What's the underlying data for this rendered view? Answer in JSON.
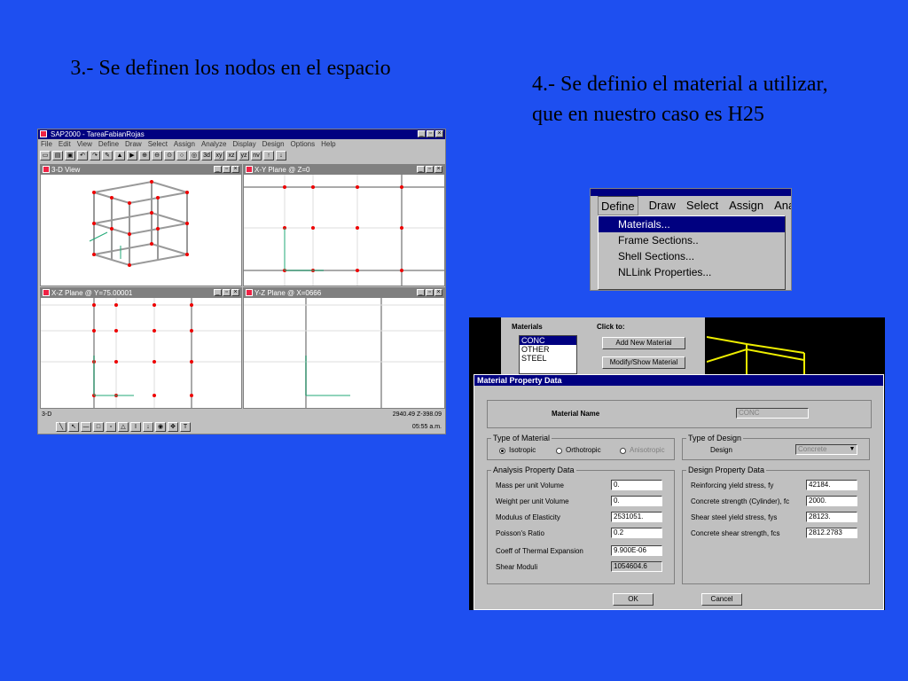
{
  "slide": {
    "caption_left": "3.- Se definen los nodos en el espacio",
    "caption_right": "4.- Se definio el material a utilizar, que en nuestro caso es H25"
  },
  "sap_window": {
    "title": "SAP2000 - TareaFabianRojas",
    "menu": [
      "File",
      "Edit",
      "View",
      "Define",
      "Draw",
      "Select",
      "Assign",
      "Analyze",
      "Display",
      "Design",
      "Options",
      "Help"
    ],
    "toolbar_labels": [
      "3d",
      "xy",
      "xz",
      "yz",
      "nv"
    ],
    "views": [
      {
        "title": "3-D View"
      },
      {
        "title": "X-Y Plane @ Z=0"
      },
      {
        "title": "X-Z Plane @ Y=75.00001"
      },
      {
        "title": "Y-Z Plane @ X=0666"
      }
    ],
    "status_coords": "2940.49 Z-398.09",
    "status_left": "3-D",
    "clock": "05:55 a.m."
  },
  "define_menu": {
    "menubar": [
      "Define",
      "Draw",
      "Select",
      "Assign",
      "Analyze"
    ],
    "items": [
      "Materials...",
      "Frame Sections..",
      "Shell Sections...",
      "NLLink Properties..."
    ],
    "highlighted_index": 0
  },
  "materials_panel": {
    "materials_label": "Materials",
    "materials": [
      "CONC",
      "OTHER",
      "STEEL"
    ],
    "click_to_label": "Click to:",
    "add_button": "Add New Material",
    "modify_button": "Modify/Show Material"
  },
  "material_dialog": {
    "title": "Material Property Data",
    "material_name_label": "Material Name",
    "material_name_value": "CONC",
    "type_of_material_label": "Type of Material",
    "type_options": [
      "Isotropic",
      "Orthotropic",
      "Anisotropic"
    ],
    "type_selected": "Isotropic",
    "type_of_design_label": "Type of Design",
    "design_label": "Design",
    "design_value": "Concrete",
    "analysis_label": "Analysis Property Data",
    "analysis": [
      {
        "label": "Mass per unit Volume",
        "value": "0."
      },
      {
        "label": "Weight per unit Volume",
        "value": "0."
      },
      {
        "label": "Modulus of Elasticity",
        "value": "2531051."
      },
      {
        "label": "Poisson's Ratio",
        "value": "0.2"
      },
      {
        "label": "Coeff of Thermal Expansion",
        "value": "9.900E-06"
      },
      {
        "label": "Shear Moduli",
        "value": "1054604.6"
      }
    ],
    "design_props_label": "Design Property Data",
    "design_props": [
      {
        "label": "Reinforcing yield stress, fy",
        "value": "42184."
      },
      {
        "label": "Concrete strength (Cylinder), fc",
        "value": "2000."
      },
      {
        "label": "Shear steel yield stress, fys",
        "value": "28123."
      },
      {
        "label": "Concrete shear strength, fcs",
        "value": "2812.2783"
      }
    ],
    "ok_button": "OK",
    "cancel_button": "Cancel"
  }
}
